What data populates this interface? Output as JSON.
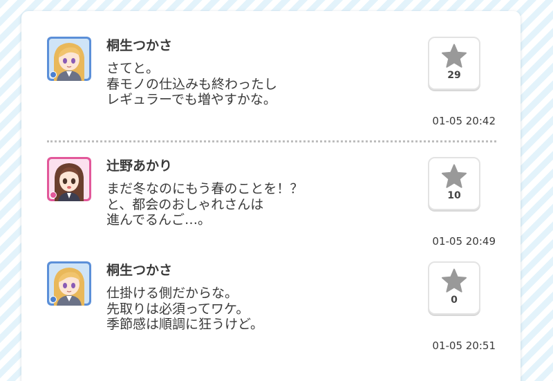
{
  "theme": {
    "background_stripe": "#e3f3fb",
    "card_bg": "#ffffff",
    "text_color": "#3a3a3a",
    "star_color": "#999999",
    "divider_color": "#bdbdbd"
  },
  "posts": [
    {
      "author": "桐生つかさ",
      "avatar": "tsukasa-avatar",
      "avatar_frame": "#5b8fd8",
      "lines": [
        "さてと。",
        "春モノの仕込みも終わったし",
        "レギュラーでも増やすかな。"
      ],
      "likes": "29",
      "timestamp": "01-05 20:42"
    },
    {
      "author": "辻野あかり",
      "avatar": "akari-avatar",
      "avatar_frame": "#e2589a",
      "lines": [
        "まだ冬なのにもう春のことを！？",
        "と、都会のおしゃれさんは",
        "進んでるんご…。"
      ],
      "likes": "10",
      "timestamp": "01-05 20:49"
    },
    {
      "author": "桐生つかさ",
      "avatar": "tsukasa-avatar",
      "avatar_frame": "#5b8fd8",
      "lines": [
        "仕掛ける側だからな。",
        "先取りは必須ってワケ。",
        "季節感は順調に狂うけど。"
      ],
      "likes": "0",
      "timestamp": "01-05 20:51"
    }
  ]
}
